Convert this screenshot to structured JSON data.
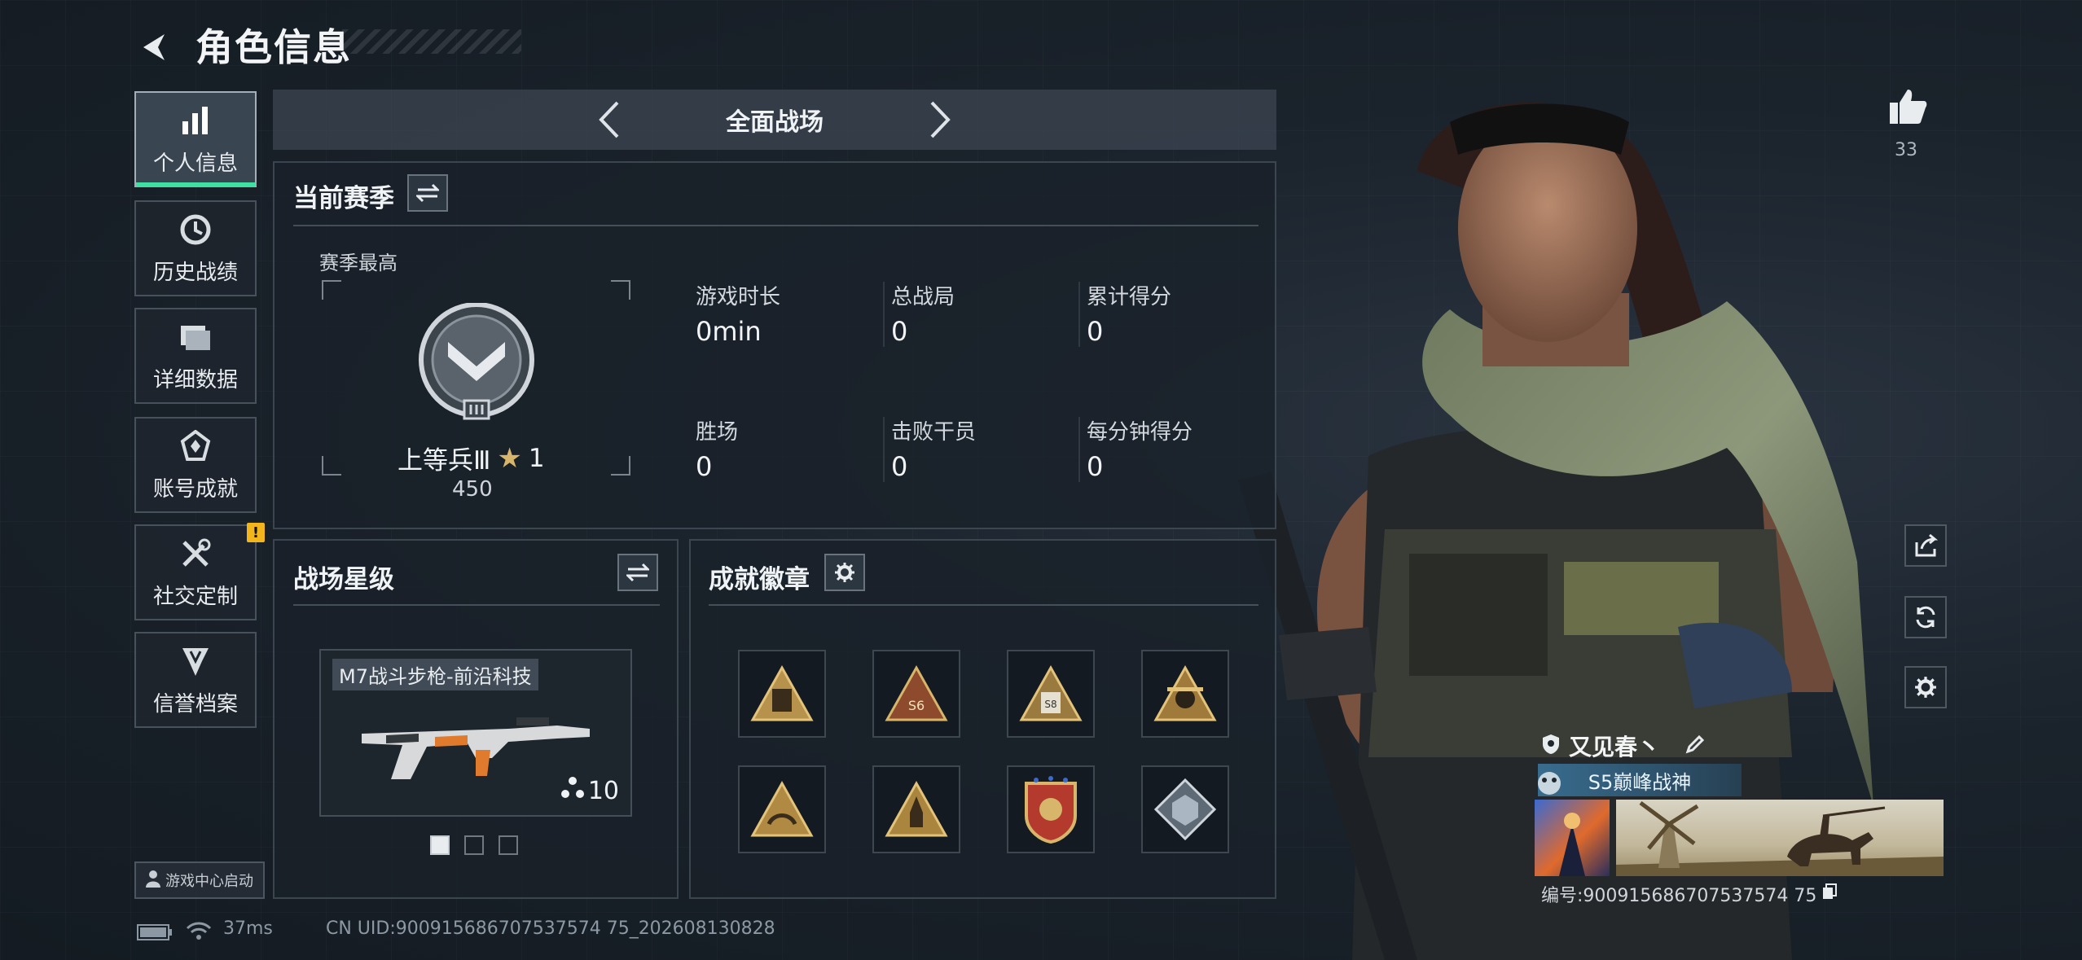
{
  "header": {
    "title": "角色信息"
  },
  "sidebar": {
    "items": [
      {
        "label": "个人信息",
        "icon": "bar-chart-icon",
        "active": true
      },
      {
        "label": "历史战绩",
        "icon": "clock-icon",
        "active": false
      },
      {
        "label": "详细数据",
        "icon": "folder-icon",
        "active": false
      },
      {
        "label": "账号成就",
        "icon": "achievement-icon",
        "active": false
      },
      {
        "label": "社交定制",
        "icon": "tools-icon",
        "active": false,
        "alert": "!"
      },
      {
        "label": "信誉档案",
        "icon": "shield-wings-icon",
        "active": false
      }
    ],
    "launch_label": "游戏中心启动"
  },
  "mode": {
    "title": "全面战场"
  },
  "season": {
    "title": "当前赛季",
    "best_label": "赛季最高",
    "rank_name": "上等兵Ⅲ",
    "rank_stars": "1",
    "rank_points": "450",
    "stats": [
      {
        "label": "游戏时长",
        "value": "0min"
      },
      {
        "label": "总战局",
        "value": "0"
      },
      {
        "label": "累计得分",
        "value": "0"
      },
      {
        "label": "胜场",
        "value": "0"
      },
      {
        "label": "击败干员",
        "value": "0"
      },
      {
        "label": "每分钟得分",
        "value": "0"
      }
    ]
  },
  "star_level": {
    "title": "战场星级",
    "weapon_name": "M7战斗步枪-前沿科技",
    "weapon_level": "10"
  },
  "achievements": {
    "title": "成就徽章",
    "badges": [
      "backpack-badge",
      "s6-badge",
      "s8-badge",
      "skull-badge",
      "hands-badge",
      "rocket-badge",
      "crest-badge",
      "cube-badge"
    ]
  },
  "profile": {
    "likes": "33",
    "player_name": "又见春丶",
    "title_tag": "S5巅峰战神",
    "id_label": "编号:900915686707537574 75"
  },
  "status": {
    "ping": "37ms",
    "uid": "CN UID:900915686707537574 75_202608130828"
  },
  "colors": {
    "accent": "#3de0a0",
    "warning": "#f2b51c",
    "gold": "#d7b56a"
  }
}
